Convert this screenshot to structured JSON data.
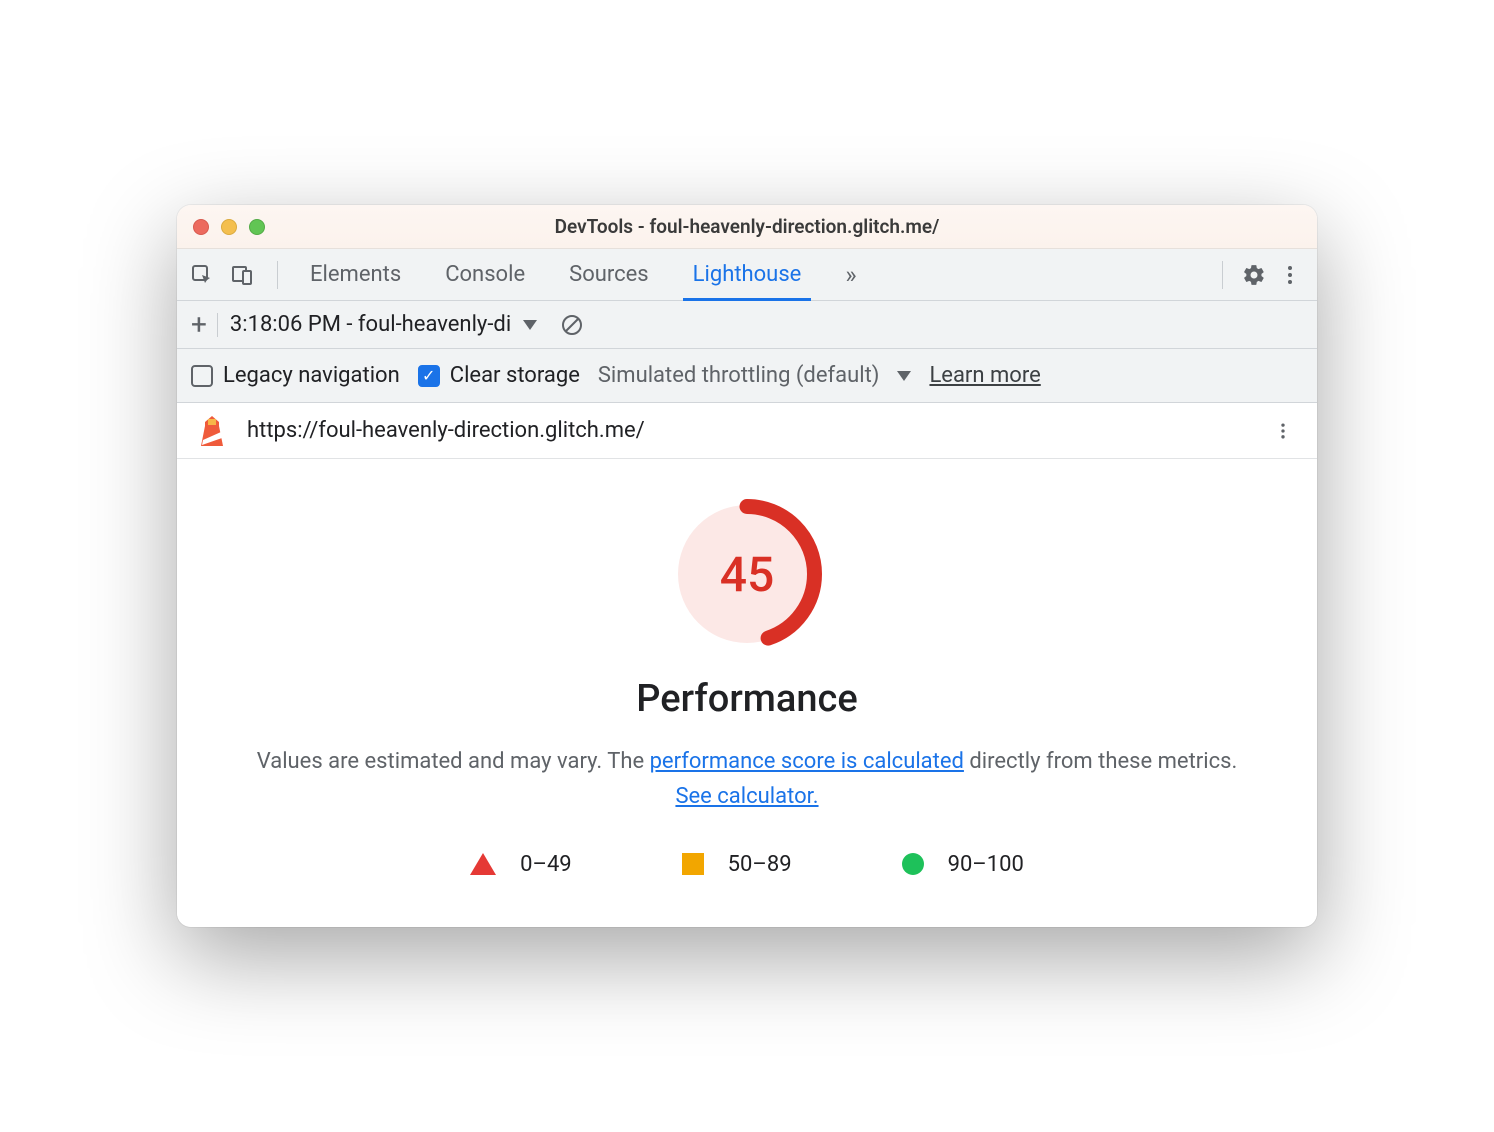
{
  "window": {
    "title": "DevTools - foul-heavenly-direction.glitch.me/"
  },
  "tabs": {
    "elements": "Elements",
    "console": "Console",
    "sources": "Sources",
    "lighthouse": "Lighthouse"
  },
  "runbar": {
    "selected": "3:18:06 PM - foul-heavenly-di"
  },
  "options": {
    "legacy_label": "Legacy navigation",
    "clear_label": "Clear storage",
    "throttle_label": "Simulated throttling (default)",
    "learn_more": "Learn more"
  },
  "url": "https://foul-heavenly-direction.glitch.me/",
  "report": {
    "score": "45",
    "heading": "Performance",
    "desc_prefix": "Values are estimated and may vary. The ",
    "link1": "performance score is calculated",
    "desc_mid": " directly from these metrics. ",
    "link2": "See calculator."
  },
  "legend": {
    "r1": "0–49",
    "r2": "50–89",
    "r3": "90–100"
  },
  "colors": {
    "fail": "#d93025",
    "accent": "#1a73e8"
  },
  "chart_data": {
    "type": "pie",
    "title": "Performance",
    "categories": [
      "score",
      "remaining"
    ],
    "values": [
      45,
      55
    ],
    "ylim": [
      0,
      100
    ]
  }
}
